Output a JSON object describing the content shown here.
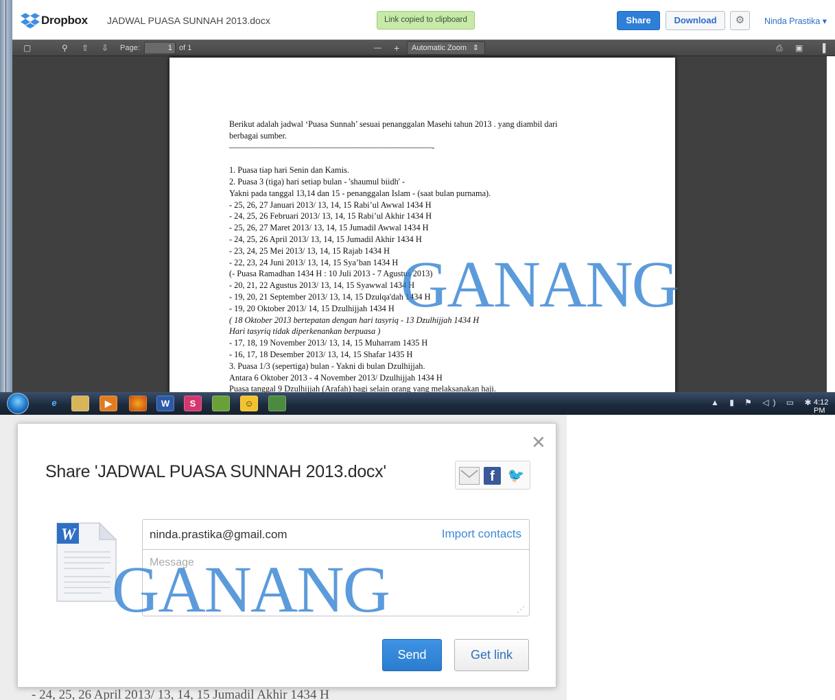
{
  "header": {
    "brand": "Dropbox",
    "file_title": "JADWAL PUASA SUNNAH 2013.docx",
    "toast": "Link copied to clipboard",
    "share_label": "Share",
    "download_label": "Download",
    "user_name": "Ninda Prastika ▾",
    "gear_icon": "gear-icon"
  },
  "toolbar": {
    "page_label": "Page:",
    "page_value": "1",
    "page_of": "of 1",
    "zoom_out": "—",
    "zoom_in": "+",
    "zoom": "Automatic Zoom"
  },
  "document": {
    "lines": [
      {
        "text": "Berikut adalah jadwal ‘Puasa Sunnah’ sesuai penanggalan Masehi tahun 2013 . yang diambil dari",
        "italic": false
      },
      {
        "text": "berbagai sumber.",
        "italic": false
      },
      {
        "text": "————————————————————————-",
        "italic": false
      },
      {
        "text": "",
        "italic": false
      },
      {
        "text": "1. Puasa tiap hari Senin dan Kamis.",
        "italic": false
      },
      {
        "text": "2. Puasa 3 (tiga) hari setiap bulan - 'shaumul biidh' -",
        "italic": false
      },
      {
        "text": "Yakni pada tanggal 13,14 dan 15 - penanggalan Islam - (saat bulan purnama).",
        "italic": false
      },
      {
        "text": "- 25, 26, 27 Januari 2013/ 13, 14, 15 Rabi’ul Awwal 1434 H",
        "italic": false
      },
      {
        "text": "- 24, 25, 26 Februari 2013/ 13, 14, 15 Rabi’ul Akhir 1434 H",
        "italic": false
      },
      {
        "text": "- 25, 26, 27 Maret 2013/ 13, 14, 15 Jumadil Awwal 1434 H",
        "italic": false
      },
      {
        "text": "- 24, 25, 26 April 2013/ 13, 14, 15 Jumadil Akhir 1434 H",
        "italic": false
      },
      {
        "text": "- 23, 24, 25 Mei 2013/ 13, 14, 15 Rajab 1434 H",
        "italic": false
      },
      {
        "text": "- 22, 23, 24 Juni 2013/ 13, 14, 15 Sya’ban 1434 H",
        "italic": false
      },
      {
        "text": "(- Puasa Ramadhan 1434 H : 10 Juli 2013 - 7 Agustus 2013)",
        "italic": false
      },
      {
        "text": "- 20, 21, 22 Agustus 2013/ 13, 14, 15 Syawwal 1434 H",
        "italic": false
      },
      {
        "text": "- 19, 20, 21 September 2013/ 13, 14, 15 Dzulqa'dah 1434 H",
        "italic": false
      },
      {
        "text": "- 19, 20 Oktober 2013/ 14, 15 Dzulhijjah 1434 H",
        "italic": false
      },
      {
        "text": "( 18 Oktober 2013 bertepatan dengan hari tasyriq - 13 Dzulhijjah 1434 H",
        "italic": true
      },
      {
        "text": "Hari tasyriq tidak diperkenankan berpuasa )",
        "italic": true
      },
      {
        "text": "- 17, 18, 19 November 2013/ 13, 14, 15 Muharram 1435 H",
        "italic": false
      },
      {
        "text": "- 16, 17, 18 Desember 2013/ 13, 14, 15 Shafar 1435 H",
        "italic": false
      },
      {
        "text": "3. Puasa 1/3 (sepertiga) bulan - Yakni di bulan Dzulhijjah.",
        "italic": false
      },
      {
        "text": "Antara 6 Oktober 2013 - 4 November 2013/ Dzulhijjah 1434 H",
        "italic": false
      },
      {
        "text": "Puasa tanggal 9 Dzulhijjah (Arafah) bagi selain orang yang melaksanakan haji.",
        "italic": false
      }
    ]
  },
  "taskbar": {
    "time": "4:12 PM",
    "apps": [
      "ie-icon",
      "explorer-icon",
      "media-player-icon",
      "firefox-icon",
      "word-icon",
      "app-icon",
      "app-icon",
      "messenger-icon",
      "app-icon"
    ]
  },
  "share_dialog": {
    "title": "Share 'JADWAL PUASA SUNNAH 2013.docx'",
    "to_value": "ninda.prastika@gmail.com",
    "import_contacts": "Import contacts",
    "message_placeholder": "Message",
    "send_label": "Send",
    "get_link_label": "Get link",
    "close_symbol": "✕"
  },
  "background_text": "- 24, 25, 26 April 2013/ 13, 14, 15 Jumadil Akhir 1434 H",
  "watermark": "GANANG",
  "colors": {
    "accent": "#2e7fd8",
    "watermark": "#2f7fd2",
    "toast": "#c7eaa8"
  }
}
